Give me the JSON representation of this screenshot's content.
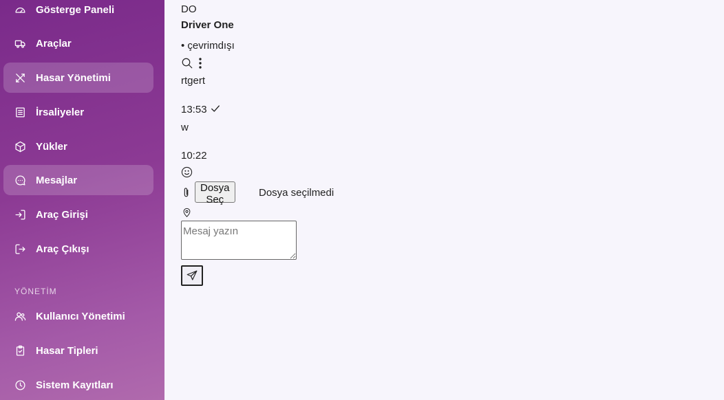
{
  "sidebar": {
    "items": [
      {
        "label": "Gösterge Paneli",
        "icon": "dashboard-icon"
      },
      {
        "label": "Araçlar",
        "icon": "truck-icon"
      },
      {
        "label": "Hasar Yönetimi",
        "icon": "tools-icon",
        "active": true
      },
      {
        "label": "İrsaliyeler",
        "icon": "document-icon"
      },
      {
        "label": "Yükler",
        "icon": "package-icon"
      },
      {
        "label": "Mesajlar",
        "icon": "chat-icon",
        "active": true
      },
      {
        "label": "Araç Girişi",
        "icon": "login-icon"
      },
      {
        "label": "Araç Çıkışı",
        "icon": "logout-icon"
      }
    ],
    "section_label": "YÖNETİM",
    "admin_items": [
      {
        "label": "Kullanıcı Yönetimi",
        "icon": "users-icon"
      },
      {
        "label": "Hasar Tipleri",
        "icon": "clipboard-icon"
      },
      {
        "label": "Sistem Kayıtları",
        "icon": "clock-icon"
      }
    ]
  },
  "chat": {
    "initials": "DO",
    "name": "Driver One",
    "status": "• çevrimdışı",
    "messages": [
      {
        "text": "rtgert",
        "time": "13:53",
        "read": true
      },
      {
        "text": "w",
        "time": "10:22",
        "read": false
      }
    ],
    "file_button": "Dosya Seç",
    "file_status": "Dosya seçilmedi",
    "input_placeholder": "Mesaj yazın"
  },
  "colors": {
    "sidebar_top": "#7a2a8a",
    "sidebar_bottom": "#b06aad",
    "content_bg": "#f7f5fc"
  }
}
